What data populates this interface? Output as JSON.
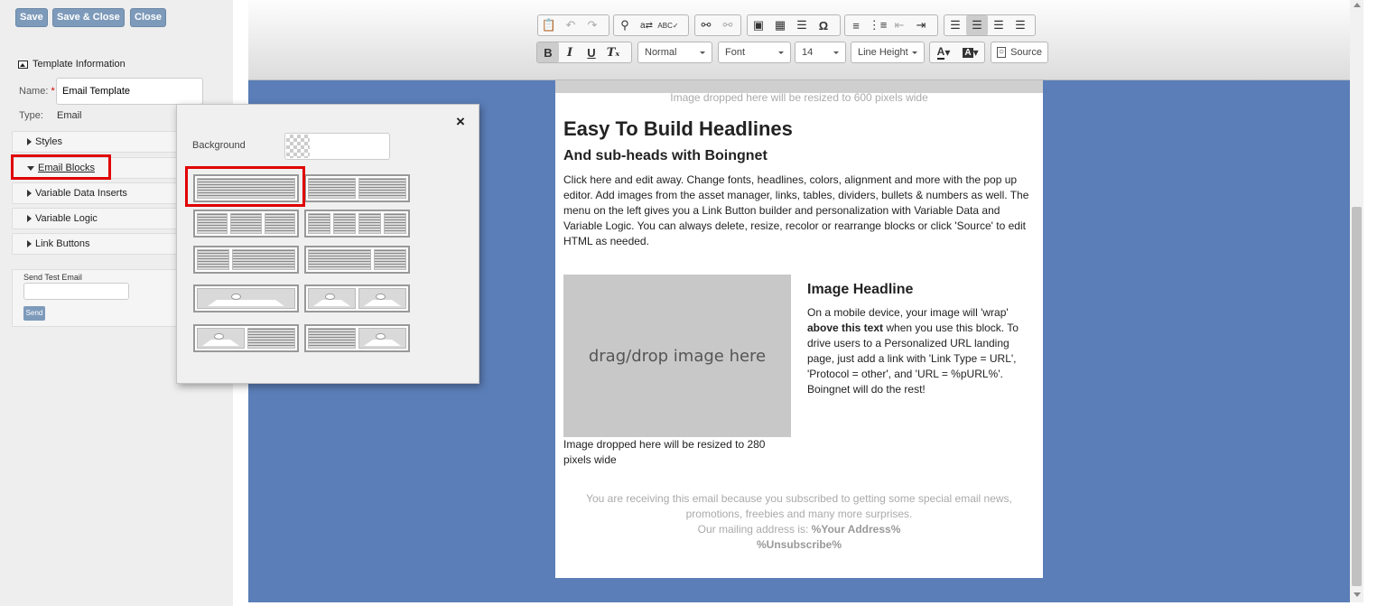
{
  "left_panel": {
    "buttons": {
      "save": "Save",
      "save_close": "Save & Close",
      "close": "Close"
    },
    "info_title": "Template Information",
    "name_label": "Name:",
    "name_required": "*",
    "name_value": "Email Template",
    "type_label": "Type:",
    "type_value": "Email",
    "accordion": [
      "Styles",
      "Email Blocks",
      "Variable Data Inserts",
      "Variable Logic",
      "Link Buttons"
    ],
    "test_label": "Send Test Email",
    "send_label": "Send"
  },
  "toolbar": {
    "format": "Normal",
    "font": "Font",
    "size": "14",
    "line_height": "Line Height",
    "source": "Source",
    "icons_row1": [
      "paste-icon",
      "undo-icon",
      "redo-icon",
      "find-icon",
      "replace-icon",
      "spellcheck-icon",
      "link-icon",
      "unlink-icon",
      "image-icon",
      "table-icon",
      "horizontal-rule-icon",
      "special-char-icon",
      "numbered-list-icon",
      "bullet-list-icon",
      "outdent-icon",
      "indent-icon",
      "align-left-icon",
      "align-center-icon",
      "align-right-icon",
      "justify-icon"
    ],
    "icons_row2": [
      "bold-icon",
      "italic-icon",
      "underline-icon",
      "remove-format-icon",
      "text-color-icon",
      "bg-color-icon",
      "source-icon"
    ]
  },
  "email": {
    "top_caption": "Image dropped here will be resized to 600 pixels wide",
    "headline": "Easy To Build Headlines",
    "subhead": "And sub-heads with Boingnet",
    "body": "Click here and edit away. Change fonts, headlines, colors, alignment and more with the pop up editor. Add images from the asset manager, links, tables, dividers, bullets & numbers as well. The menu on the left gives you a Link Button builder and personalization with Variable Data and Variable Logic. You can always delete, resize, recolor or rearrange blocks or click 'Source' to edit HTML as needed.",
    "image_placeholder": "drag/drop image here",
    "image_caption": "Image dropped here will be resized to 280 pixels wide",
    "image_headline": "Image Headline",
    "image_text_1": "On a mobile device, your image will 'wrap'",
    "image_text_bold": "above this text",
    "image_text_2": "when you use this block. To drive users to a Personalized URL landing page, just add a link with 'Link Type = URL', 'Protocol = other', and 'URL = %pURL%'. Boingnet will do the rest!",
    "footer_line1": "You are receiving this email because you subscribed to getting some special email news, promotions, freebies and many more surprises.",
    "footer_address_label": "Our mailing address is:",
    "footer_address": "%Your Address%",
    "footer_unsub": "%Unsubscribe%"
  },
  "popup": {
    "close": "×",
    "background_label": "Background",
    "blocks": [
      {
        "name": "block-full-text"
      },
      {
        "name": "block-two-text"
      },
      {
        "name": "block-three-text"
      },
      {
        "name": "block-four-text"
      },
      {
        "name": "block-narrow-wide-text"
      },
      {
        "name": "block-wide-narrow-text"
      },
      {
        "name": "block-full-image"
      },
      {
        "name": "block-two-image-text"
      },
      {
        "name": "block-image-left-text"
      },
      {
        "name": "block-text-image-right"
      }
    ]
  },
  "colors": {
    "canvas": "#5b7eb8",
    "button": "#7d9aba",
    "highlight": "#e00000"
  }
}
